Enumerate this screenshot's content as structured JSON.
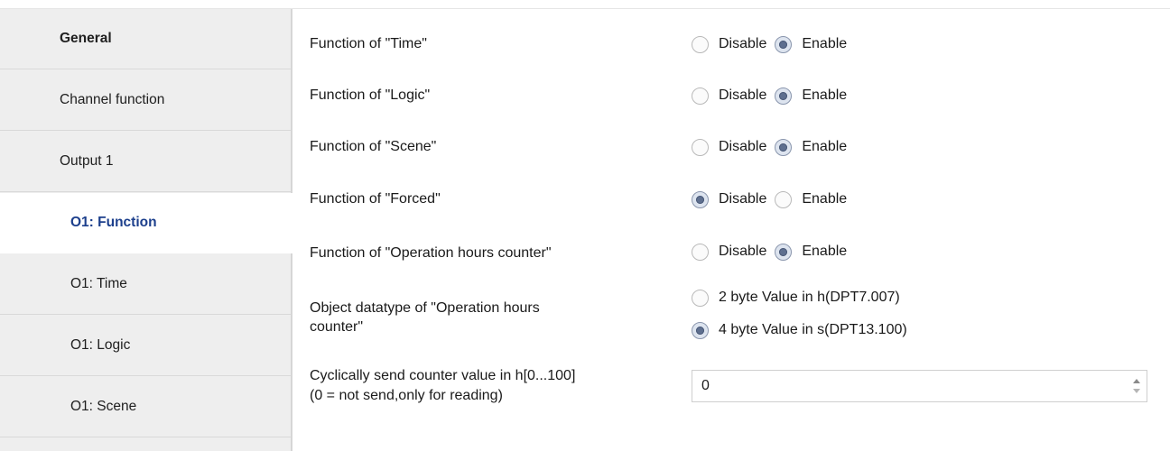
{
  "sidebar": {
    "items": [
      {
        "label": "General"
      },
      {
        "label": "Channel function"
      },
      {
        "label": "Output 1"
      },
      {
        "label": "O1: Function"
      },
      {
        "label": "O1: Time"
      },
      {
        "label": "O1: Logic"
      },
      {
        "label": "O1: Scene"
      }
    ]
  },
  "main": {
    "rows": [
      {
        "label": "Function of \"Time\"",
        "options": [
          "Disable",
          "Enable"
        ],
        "selected": "Enable"
      },
      {
        "label": "Function of \"Logic\"",
        "options": [
          "Disable",
          "Enable"
        ],
        "selected": "Enable"
      },
      {
        "label": "Function of \"Scene\"",
        "options": [
          "Disable",
          "Enable"
        ],
        "selected": "Enable"
      },
      {
        "label": "Function of \"Forced\"",
        "options": [
          "Disable",
          "Enable"
        ],
        "selected": "Disable"
      },
      {
        "label": "Function of \"Operation hours counter\"",
        "options": [
          "Disable",
          "Enable"
        ],
        "selected": "Enable"
      }
    ],
    "datatype": {
      "label_line1": "Object datatype of \"Operation hours",
      "label_line2": "counter\"",
      "options": [
        "2 byte Value in h(DPT7.007)",
        "4 byte Value in s(DPT13.100)"
      ],
      "selected": "4 byte Value in s(DPT13.100)"
    },
    "cyclic": {
      "label_line1": "Cyclically send counter value in h[0...100]",
      "label_line2": "(0 = not send,only for reading)",
      "value": "0"
    }
  }
}
